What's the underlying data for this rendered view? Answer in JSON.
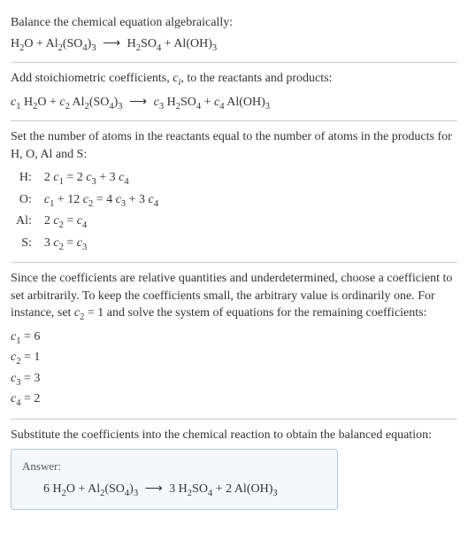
{
  "section1": {
    "title": "Balance the chemical equation algebraically:",
    "eq_lhs1": "H",
    "eq_lhs1_sub": "2",
    "eq_lhs1b": "O + Al",
    "eq_lhs1b_sub": "2",
    "eq_lhs1c": "(SO",
    "eq_lhs1c_sub": "4",
    "eq_lhs1d": ")",
    "eq_lhs1d_sub": "3",
    "arrow": "⟶",
    "eq_rhs1": "H",
    "eq_rhs1_sub": "2",
    "eq_rhs1b": "SO",
    "eq_rhs1b_sub": "4",
    "eq_rhs1c": " + Al(OH)",
    "eq_rhs1c_sub": "3"
  },
  "section2": {
    "title_a": "Add stoichiometric coefficients, ",
    "title_ci": "c",
    "title_ci_sub": "i",
    "title_b": ", to the reactants and products:",
    "c1": "c",
    "c1s": "1",
    "sp1": " H",
    "sp1s": "2",
    "sp1b": "O + ",
    "c2": "c",
    "c2s": "2",
    "sp2": " Al",
    "sp2s": "2",
    "sp2b": "(SO",
    "sp2bs": "4",
    "sp2c": ")",
    "sp2cs": "3",
    "arrow": "⟶",
    "c3": "c",
    "c3s": "3",
    "sp3": " H",
    "sp3s": "2",
    "sp3b": "SO",
    "sp3bs": "4",
    "sp3c": " + ",
    "c4": "c",
    "c4s": "4",
    "sp4": " Al(OH)",
    "sp4s": "3"
  },
  "section3": {
    "title": "Set the number of atoms in the reactants equal to the number of atoms in the products for H, O, Al and S:",
    "rows": [
      {
        "el": "H:",
        "eq_pre": "2 ",
        "c1": "c",
        "c1s": "1",
        "mid": " = 2 ",
        "c3": "c",
        "c3s": "3",
        "mid2": " + 3 ",
        "c4": "c",
        "c4s": "4"
      },
      {
        "el": "O:",
        "eq_pre": "",
        "c1": "c",
        "c1s": "1",
        "mid": " + 12 ",
        "c2": "c",
        "c2s": "2",
        "mid1b": " = 4 ",
        "c3": "c",
        "c3s": "3",
        "mid2": " + 3 ",
        "c4": "c",
        "c4s": "4"
      },
      {
        "el": "Al:",
        "eq_pre": "2 ",
        "c2": "c",
        "c2s": "2",
        "mid": " = ",
        "c4": "c",
        "c4s": "4"
      },
      {
        "el": "S:",
        "eq_pre": "3 ",
        "c2": "c",
        "c2s": "2",
        "mid": " = ",
        "c3": "c",
        "c3s": "3"
      }
    ]
  },
  "section4": {
    "text_a": "Since the coefficients are relative quantities and underdetermined, choose a coefficient to set arbitrarily. To keep the coefficients small, the arbitrary value is ordinarily one. For instance, set ",
    "c2": "c",
    "c2s": "2",
    "text_b": " = 1 and solve the system of equations for the remaining coefficients:",
    "coeffs": [
      {
        "c": "c",
        "cs": "1",
        "val": " = 6"
      },
      {
        "c": "c",
        "cs": "2",
        "val": " = 1"
      },
      {
        "c": "c",
        "cs": "3",
        "val": " = 3"
      },
      {
        "c": "c",
        "cs": "4",
        "val": " = 2"
      }
    ]
  },
  "section5": {
    "title": "Substitute the coefficients into the chemical reaction to obtain the balanced equation:",
    "answer_label": "Answer:",
    "ans_a": "6 H",
    "ans_as": "2",
    "ans_b": "O + Al",
    "ans_bs": "2",
    "ans_c": "(SO",
    "ans_cs": "4",
    "ans_d": ")",
    "ans_ds": "3",
    "arrow": "⟶",
    "ans_e": "3 H",
    "ans_es": "2",
    "ans_f": "SO",
    "ans_fs": "4",
    "ans_g": " + 2 Al(OH)",
    "ans_gs": "3"
  }
}
